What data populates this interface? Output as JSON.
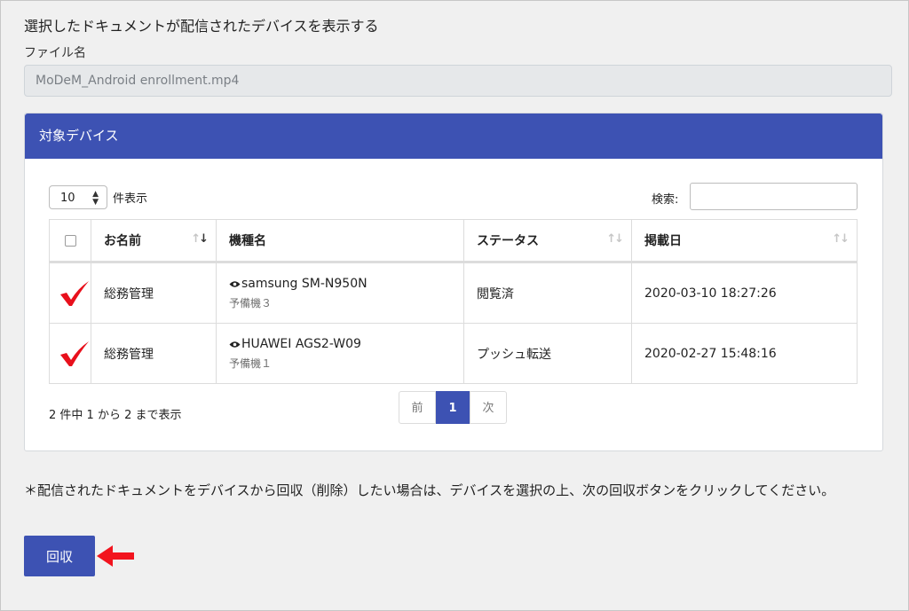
{
  "heading": "選択したドキュメントが配信されたデバイスを表示する",
  "file": {
    "label": "ファイル名",
    "value": "MoDeM_Android enrollment.mp4"
  },
  "panel": {
    "title": "対象デバイス"
  },
  "table_controls": {
    "page_length": "10",
    "length_suffix": "件表示",
    "search_label": "検索:",
    "search_value": ""
  },
  "columns": [
    "お名前",
    "機種名",
    "ステータス",
    "掲載日"
  ],
  "rows": [
    {
      "name": "総務管理",
      "device": "samsung SM-N950N",
      "device_sub": "予備機３",
      "status": "閲覧済",
      "date": "2020-03-10 18:27:26",
      "selected": true
    },
    {
      "name": "総務管理",
      "device": "HUAWEI AGS2-W09",
      "device_sub": "予備機１",
      "status": "プッシュ転送",
      "date": "2020-02-27 15:48:16",
      "selected": true
    }
  ],
  "info": "2 件中 1 から 2 まで表示",
  "pagination": {
    "prev": "前",
    "current": "1",
    "next": "次"
  },
  "notice": "＊配信されたドキュメントをデバイスから回収（削除）したい場合は、デバイスを選択の上、次の回収ボタンをクリックしてください。",
  "action_button": "回収",
  "colors": {
    "primary": "#3d52b3",
    "check_mark": "#e8101c",
    "arrow": "#f2141e"
  }
}
